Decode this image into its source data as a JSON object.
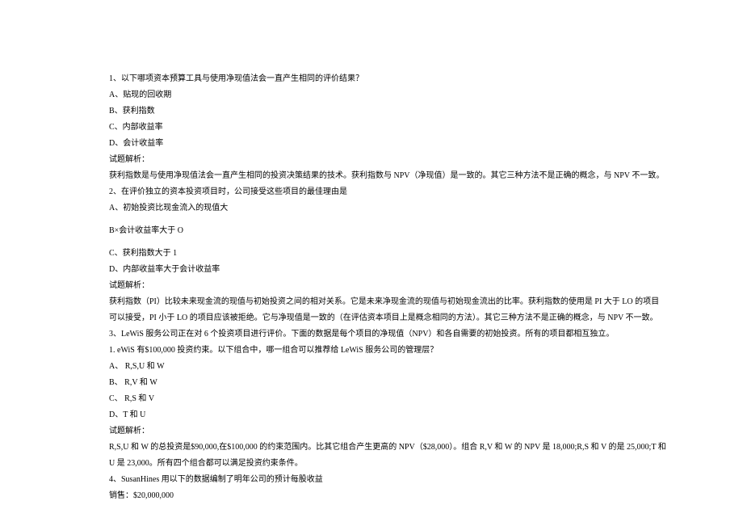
{
  "lines": [
    "1、以下哪项资本预算工具与使用净现值法会一直产生相同的评价结果？",
    "A、贴现的回收期",
    "B、获利指数",
    "C、内部收益率",
    "D、会计收益率",
    "试题解析：",
    "获利指数是与使用净现值法会一直产生相同的投资决策结果的技术。获利指数与 NPV（净现值）是一致的。其它三种方法不是正确的概念，与 NPV 不一致。",
    "2、在评价独立的资本投资项目时，公司接受这些项目的最佳理由是",
    "A、初始投资比现金流入的现值大",
    "B×会计收益率大于 O",
    "C、获利指数大于 1",
    "D、内部收益率大于会计收益率",
    "试题解析：",
    "获利指数（PI）比较未来现金流的现值与初始投资之间的相对关系。它是未来净现金流的现值与初始现金流出的比率。获利指数的使用是 PI 大于 LO 的项目可以接受，PI 小于 LO 的项目应该被拒绝。它与净现值是一致的（在评估资本项目上是概念相同的方法）。其它三种方法不是正确的概念，与 NPV 不一致。",
    "3、LeWiS 服务公司正在对 6 个投资项目进行评价。下面的数据是每个项目的净现值（NPV）和各自需要的初始投资。所有的项目都相互独立。",
    "1. eWiS 有$100,000 投资约束。以下组合中，哪一组合可以推荐给 LeWiS 服务公司的管理层？",
    "A、   R,S,U 和 W",
    "B、   R,V 和 W",
    "C、   R,S 和 V",
    "D、T 和 U",
    "试题解析：",
    "R,S,U 和 W 的总投资是$90,000,在$100,000 的约束范围内。比其它组合产生更高的 NPV（$28,000）。组合 R,V 和 W 的 NPV 是 18,000;R,S 和 V 的是 25,000;T 和 U 是 23,000。所有四个组合都可以满足投资约束条件。",
    "4、SusanHines 用以下的数据编制了明年公司的预计每股收益",
    "销售：$20,000,000"
  ],
  "gap_after": [
    8,
    9
  ]
}
